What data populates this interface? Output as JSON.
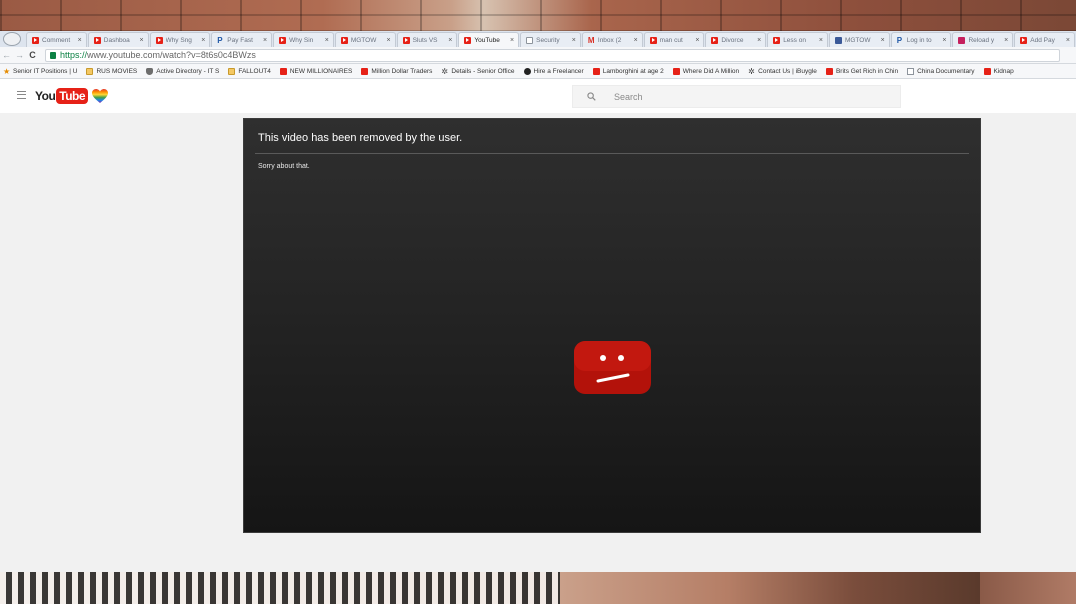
{
  "browser": {
    "tabs": [
      {
        "label": "Comment",
        "icon": "youtube",
        "active": false
      },
      {
        "label": "Dashboa",
        "icon": "youtube",
        "active": false
      },
      {
        "label": "Why Sng",
        "icon": "youtube",
        "active": false
      },
      {
        "label": "Pay Fast",
        "icon": "paypal",
        "active": false
      },
      {
        "label": "Why Sin",
        "icon": "youtube",
        "active": false
      },
      {
        "label": "MGTOW",
        "icon": "youtube",
        "active": false
      },
      {
        "label": "Sluts VS",
        "icon": "youtube",
        "active": false
      },
      {
        "label": "YouTube",
        "icon": "youtube",
        "active": true
      },
      {
        "label": "Security",
        "icon": "doc",
        "active": false
      },
      {
        "label": "Inbox (2",
        "icon": "gmail",
        "active": false
      },
      {
        "label": "man cut",
        "icon": "youtube",
        "active": false
      },
      {
        "label": "Divorce",
        "icon": "youtube",
        "active": false
      },
      {
        "label": "Less on",
        "icon": "youtube",
        "active": false
      },
      {
        "label": "MGTOW",
        "icon": "facebook",
        "active": false
      },
      {
        "label": "Log in to",
        "icon": "paypal",
        "active": false
      },
      {
        "label": "Reload y",
        "icon": "vb",
        "active": false
      },
      {
        "label": "Add Pay",
        "icon": "youtube",
        "active": false
      }
    ],
    "tab_close": "×",
    "nav": {
      "back": "←",
      "forward": "→",
      "reload": "C"
    },
    "url_scheme": "https://",
    "url_rest": "www.youtube.com/watch?v=8t6s0c4BWzs",
    "bookmarks": [
      {
        "label": "Senior IT Positions | U",
        "icon": "star"
      },
      {
        "label": "RUS MOVIES",
        "icon": "folder"
      },
      {
        "label": "Active Directory - IT S",
        "icon": "shield"
      },
      {
        "label": "FALLOUT4",
        "icon": "folder"
      },
      {
        "label": "NEW MILLIONAIRES",
        "icon": "youtube"
      },
      {
        "label": "Million Dollar Traders",
        "icon": "youtube"
      },
      {
        "label": "Details - Senior Office",
        "icon": "run"
      },
      {
        "label": "Hire a Freelancer",
        "icon": "dark"
      },
      {
        "label": "Lamborghini at age 2",
        "icon": "youtube"
      },
      {
        "label": "Where Did A Million",
        "icon": "youtube"
      },
      {
        "label": "Contact Us | iBuygle",
        "icon": "run"
      },
      {
        "label": "Brits Get Rich in Chin",
        "icon": "youtube"
      },
      {
        "label": "China Documentary",
        "icon": "doc"
      },
      {
        "label": "Kidnap",
        "icon": "youtube"
      }
    ]
  },
  "youtube": {
    "logo_you": "You",
    "logo_tube": "Tube",
    "search_placeholder": "Search",
    "error_title": "This video has been removed by the user.",
    "error_subtitle": "Sorry about that."
  },
  "colors": {
    "youtube_red": "#e62117",
    "player_bg": "#242424"
  }
}
